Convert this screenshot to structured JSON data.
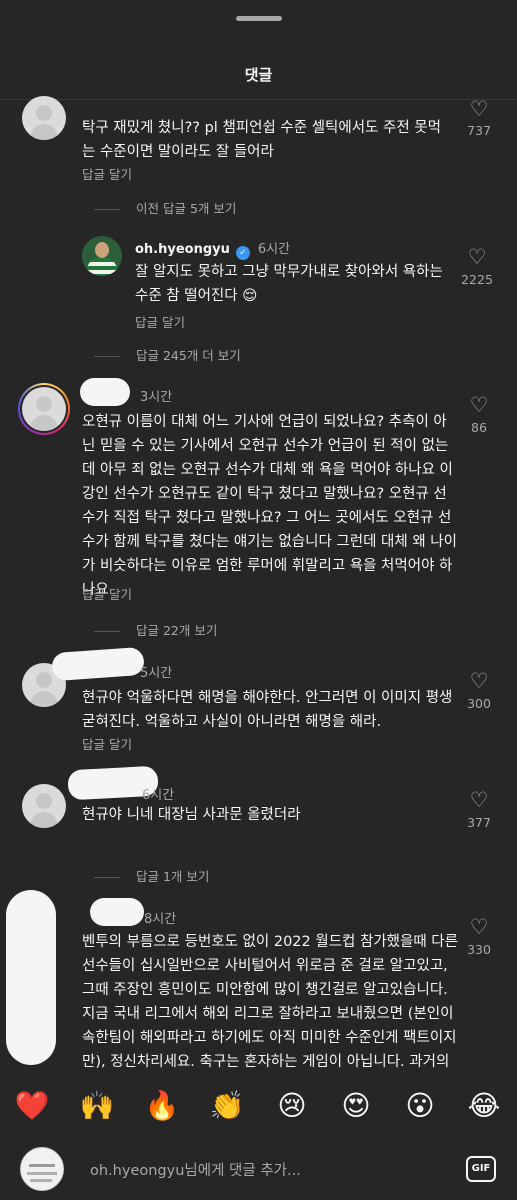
{
  "sheet": {
    "title": "댓글"
  },
  "comments": [
    {
      "text": "탁구 재밌게 쳤니?? pl 챔피언쉽 수준 셀틱에서도 주전 못먹는 수준이면 말이라도 잘 들어라",
      "reply_label": "답글 달기",
      "likes": "737"
    },
    {
      "username": "oh.hyeongyu",
      "time": "6시간",
      "text": "잘 알지도 못하고 그냥 막무가내로 찾아와서 욕하는 수준 참 떨어진다 😌",
      "reply_label": "답글 달기",
      "likes": "2225"
    },
    {
      "time": "3시간",
      "text": "오현규 이름이 대체 어느 기사에 언급이 되었나요? 추측이 아닌 믿을 수 있는 기사에서 오현규 선수가 언급이 된 적이 없는데 아무 죄 없는 오현규 선수가 대체 왜 욕을 먹어야 하나요 이강인 선수가 오현규도 같이 탁구 쳤다고 말했나요? 오현규 선수가 직접 탁구 쳤다고 말했나요? 그 어느 곳에서도 오현규 선수가 함께 탁구를 쳤다는 얘기는 없습니다 그런데 대체 왜 나이가 비슷하다는 이유로 엄한 루머에 휘말리고 욕을 처먹어야 하나요",
      "reply_label": "답글 달기",
      "likes": "86"
    },
    {
      "time": "5시간",
      "text": "현규야 억울하다면 해명을 해야한다. 안그러면 이 이미지 평생 굳혀진다. 억울하고 사실이 아니라면 해명을 해라.",
      "reply_label": "답글 달기",
      "likes": "300"
    },
    {
      "time": "6시간",
      "text": "현규야 니네 대장님 사과문 올렸더라",
      "likes": "377"
    },
    {
      "time": "8시간",
      "text": "벤투의 부름으로 등번호도 없이 2022 월드컵 참가했을때 다른 선수들이 십시일반으로 사비털어서 위로금 준 걸로 알고있고, 그때 주장인 흥민이도 미안함에 많이 챙긴걸로 알고있습니다. 지금 국내 리그에서 해외 리그로 잘하라고 보내줬으면 (본인이 속한팀이 해외파라고 하기에도 아직 미미한 수준인게 팩트이지만), 정신차리세요. 축구는 혼자하는 게임이 아닙니다. 과거의 본인이 어떤 시절이 있었는지 잊지",
      "likes": "330"
    }
  ],
  "threads": {
    "prev_replies": "이전 답글 5개 보기",
    "more_replies": "답글 245개 더 보기",
    "view_22": "답글 22개 보기",
    "view_1": "답글 1개 보기"
  },
  "emoji_bar": [
    "❤️",
    "🙌",
    "🔥",
    "👏",
    "😢",
    "😍",
    "😮",
    "😂"
  ],
  "composer": {
    "placeholder": "oh.hyeongyu님에게 댓글 추가...",
    "gif_label": "GIF"
  }
}
